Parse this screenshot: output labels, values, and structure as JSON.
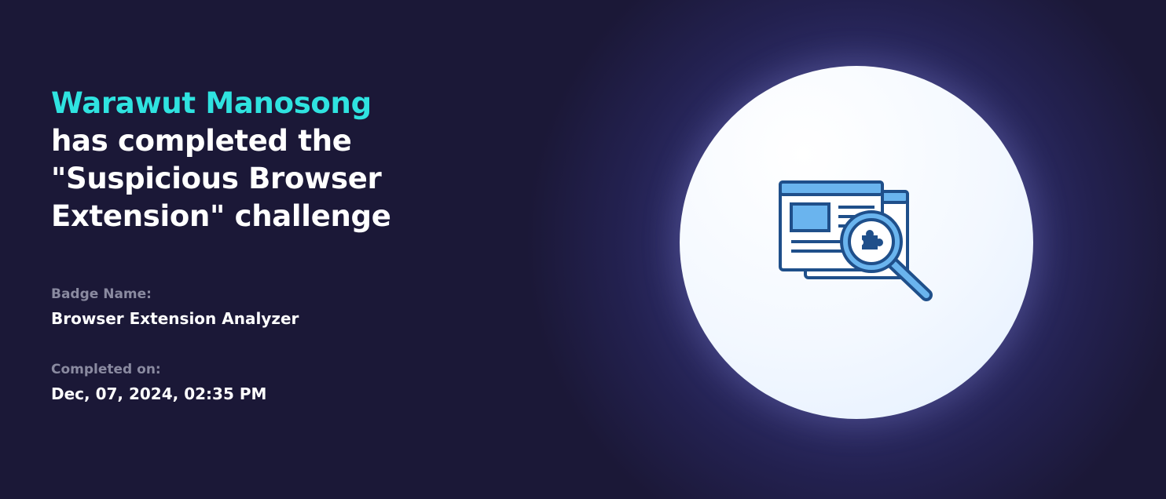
{
  "certificate": {
    "name": "Warawut Manosong",
    "headline_rest": "has completed the \"Suspicious Browser Extension\" challenge",
    "badge_label": "Badge Name:",
    "badge_value": "Browser Extension Analyzer",
    "completed_label": "Completed on:",
    "completed_value": "Dec, 07, 2024, 02:35 PM"
  },
  "badge": {
    "icon": "browser-extension-magnifier-icon"
  },
  "colors": {
    "background": "#1b1837",
    "accent": "#2fe3e0",
    "label_gray": "#8a8aa0",
    "icon_outline": "#1f4f8a",
    "icon_fill": "#6ab4ee"
  }
}
